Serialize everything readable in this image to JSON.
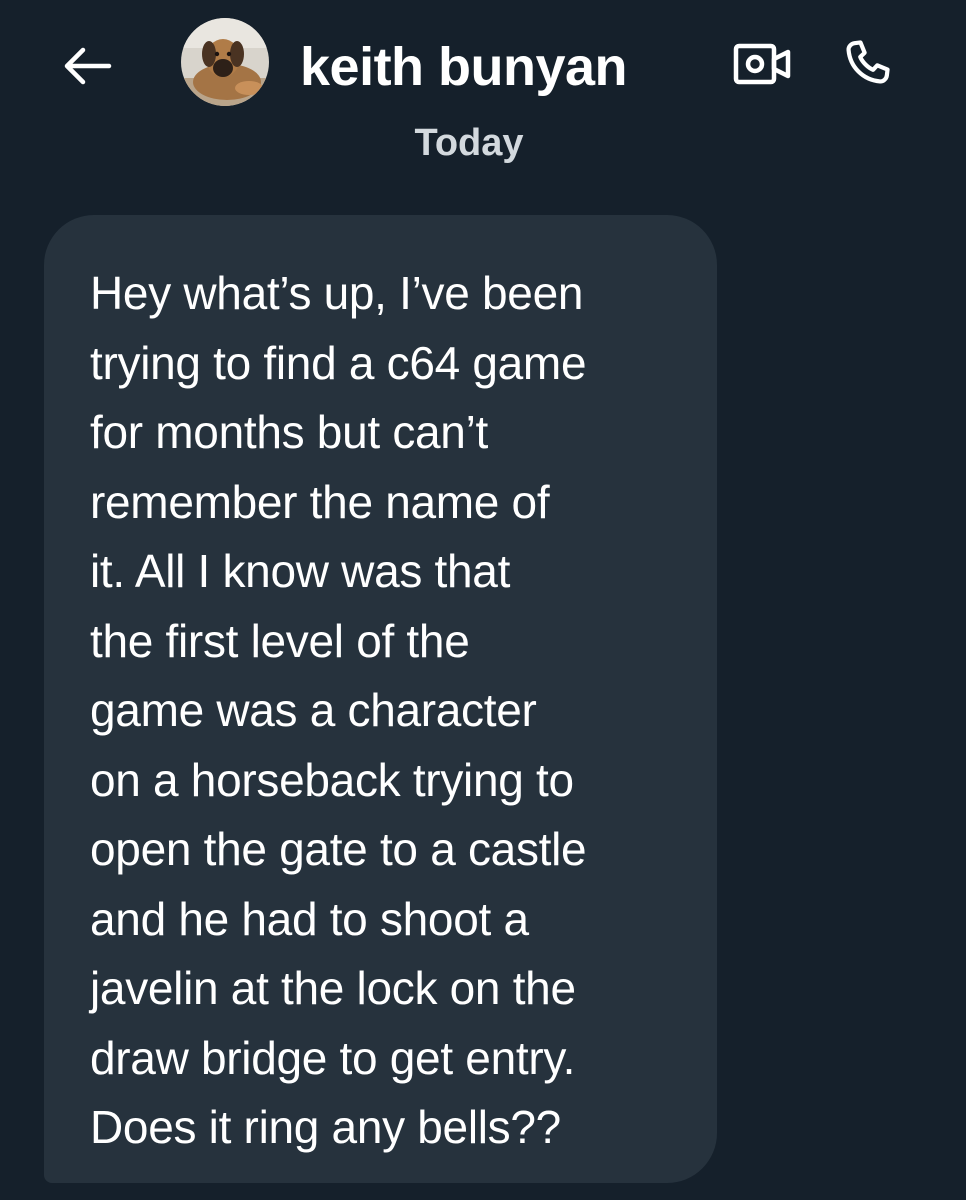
{
  "header": {
    "back_icon": "arrow-left-icon",
    "avatar_icon": "dog-avatar",
    "contact_name": "keith bunyan",
    "video_icon": "video-camera-icon",
    "call_icon": "phone-icon"
  },
  "conversation": {
    "date_divider": "Today",
    "messages": [
      {
        "direction": "incoming",
        "text": "Hey what’s up, I’ve been\ntrying to find a c64 game\nfor months but can’t\nremember the name of\nit. All I know was that\nthe first level of the\ngame was a character\non a horseback trying to\nopen the gate to a castle\nand he had to shoot a\njavelin at the lock on the\ndraw bridge to get entry.\nDoes it ring any bells??"
      }
    ]
  },
  "colors": {
    "background": "#15202b",
    "bubble": "#26323d",
    "text": "#ffffff",
    "muted_text": "#d3d9de"
  }
}
